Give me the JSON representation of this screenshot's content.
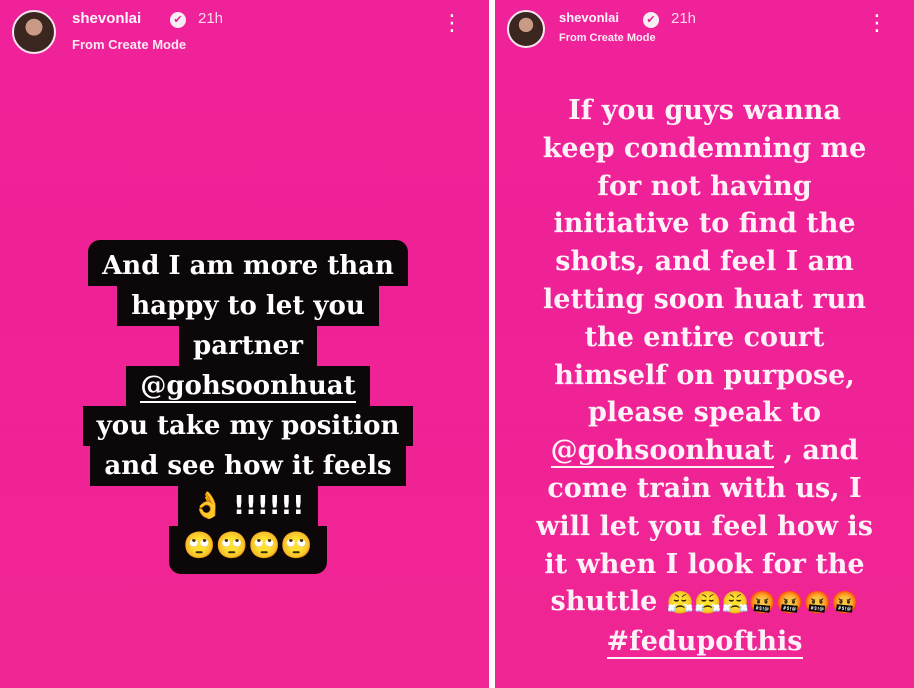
{
  "left_story": {
    "header": {
      "username": "shevonlai",
      "verified_glyph": "✔",
      "time": "21h",
      "subtitle": "From Create Mode",
      "more_glyph": "⋮"
    },
    "text_lines": [
      "And I am more than",
      "happy to let you",
      "partner",
      "@gohsoonhuat",
      "you take my position",
      "and see how it feels",
      "👌 !!!!!!",
      "🙄🙄🙄🙄"
    ]
  },
  "right_story": {
    "header": {
      "username": "shevonlai",
      "verified_glyph": "✔",
      "time": "21h",
      "subtitle": "From Create Mode",
      "more_glyph": "⋮"
    },
    "text_lines": [
      "If you guys wanna",
      "keep condemning me",
      "for not having",
      "initiative to find the",
      "shots, and feel I am",
      "letting soon huat run",
      "the entire court",
      "himself on purpose,",
      "please speak to"
    ],
    "mention": "@gohsoonhuat",
    "mention_suffix": " , and",
    "text_lines_2": [
      "come train with us, I",
      "will let you feel how is",
      "it when I look for the"
    ],
    "shuttle_word": "shuttle ",
    "shuttle_emojis": "😤😤😤🤬🤬🤬🤬",
    "hashtag": "#fedupofthis"
  },
  "colors": {
    "background": "#ef2196",
    "text_box": "#0c0709",
    "text": "#ffffff"
  }
}
